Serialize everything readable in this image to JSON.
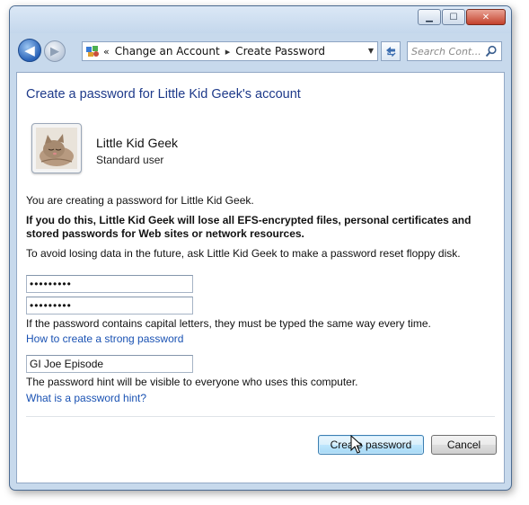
{
  "window": {
    "buttons": {
      "minimize": "▁",
      "maximize": "☐",
      "close": "✕"
    }
  },
  "nav": {
    "back_glyph": "◀",
    "forward_glyph": "▶",
    "breadcrumb": [
      "Change an Account",
      "Create Password"
    ],
    "breadcrumb_separator": "▸",
    "search_placeholder": "Search Cont...",
    "icons": {
      "address_icon": "control-panel-icon",
      "refresh": "refresh-icon",
      "search": "search-icon"
    }
  },
  "page": {
    "title": "Create a password for Little Kid Geek's account",
    "user": {
      "name": "Little Kid Geek",
      "type": "Standard user",
      "avatar": "kitten-avatar"
    },
    "intro": "You are creating a password for Little Kid Geek.",
    "warning": "If you do this, Little Kid Geek will lose all EFS-encrypted files, personal certificates and stored passwords for Web sites or network resources.",
    "advice": "To avoid losing data in the future, ask Little Kid Geek to make a password reset floppy disk.",
    "new_password_value": "•••••••••",
    "confirm_password_value": "•••••••••",
    "case_note": "If the password contains capital letters, they must be typed the same way every time.",
    "strong_password_link": "How to create a strong password",
    "hint_value": "GI Joe Episode",
    "hint_note": "The password hint will be visible to everyone who uses this computer.",
    "hint_link": "What is a password hint?",
    "create_button": "Create password",
    "cancel_button": "Cancel"
  },
  "colors": {
    "title": "#1e3a8a",
    "link": "#1a52b3",
    "frame": "#c7d9ec"
  }
}
